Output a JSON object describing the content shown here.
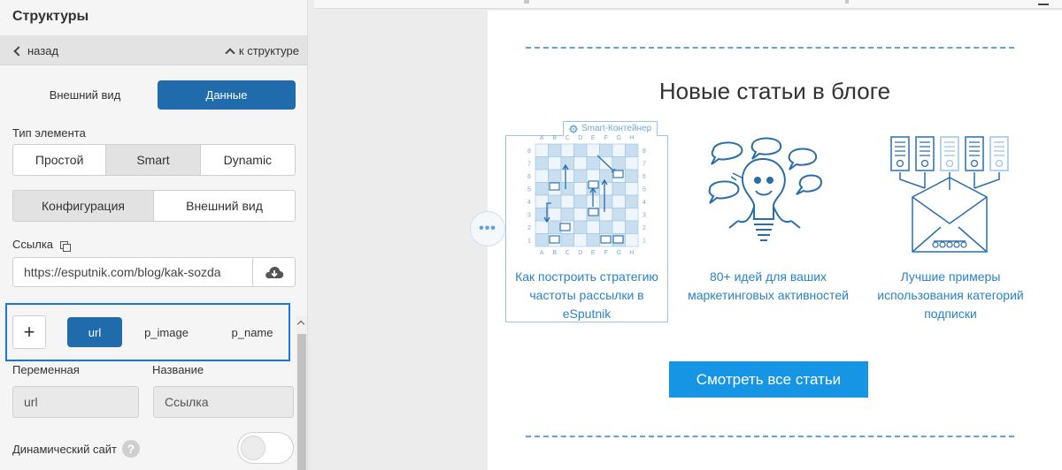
{
  "panel": {
    "title": "Структуры",
    "nav": {
      "back": "назад",
      "to_structure": "к структуре"
    },
    "view_tabs": {
      "appearance": "Внешний вид",
      "data": "Данные"
    },
    "element_type": {
      "label": "Тип элемента",
      "options": [
        "Простой",
        "Smart",
        "Dynamic"
      ],
      "selected": "Smart"
    },
    "config_tabs": {
      "options": [
        "Конфигурация",
        "Внешний вид"
      ],
      "selected": "Конфигурация"
    },
    "link": {
      "label": "Ссылка",
      "value": "https://esputnik.com/blog/kak-sozda"
    },
    "variables": {
      "tabs": [
        "url",
        "p_image",
        "p_name"
      ],
      "selected": "url"
    },
    "variable_label": "Переменная",
    "name_label": "Название",
    "variable_value": "url",
    "name_value": "Ссылка",
    "dynamic_site": {
      "label": "Динамический сайт",
      "enabled": false
    }
  },
  "preview": {
    "heading": "Новые статьи в блоге",
    "smart_badge": "Smart-Контейнер",
    "articles": [
      {
        "line1": "Как построить стратегию",
        "line2": "частоты рассылки в",
        "line3": "eSputnik",
        "icon": "chessboard-icon"
      },
      {
        "line1": "80+ идей для ваших",
        "line2": "маркетинговых активностей",
        "line3": "",
        "icon": "lightbulb-icon"
      },
      {
        "line1": "Лучшие примеры",
        "line2": "использования категорий",
        "line3": "подписки",
        "icon": "envelope-icon"
      }
    ],
    "cta": "Смотреть все статьи",
    "chess": {
      "cols": [
        "A",
        "B",
        "C",
        "D",
        "E",
        "F",
        "G",
        "H"
      ],
      "rows": [
        "8",
        "7",
        "6",
        "5",
        "4",
        "3",
        "2",
        "1"
      ]
    },
    "colors": {
      "accent": "#1f6bab",
      "cta": "#1595e3",
      "link": "#2a82c7",
      "dash": "#5ea4d6",
      "highlight": "#1a73e8"
    }
  }
}
